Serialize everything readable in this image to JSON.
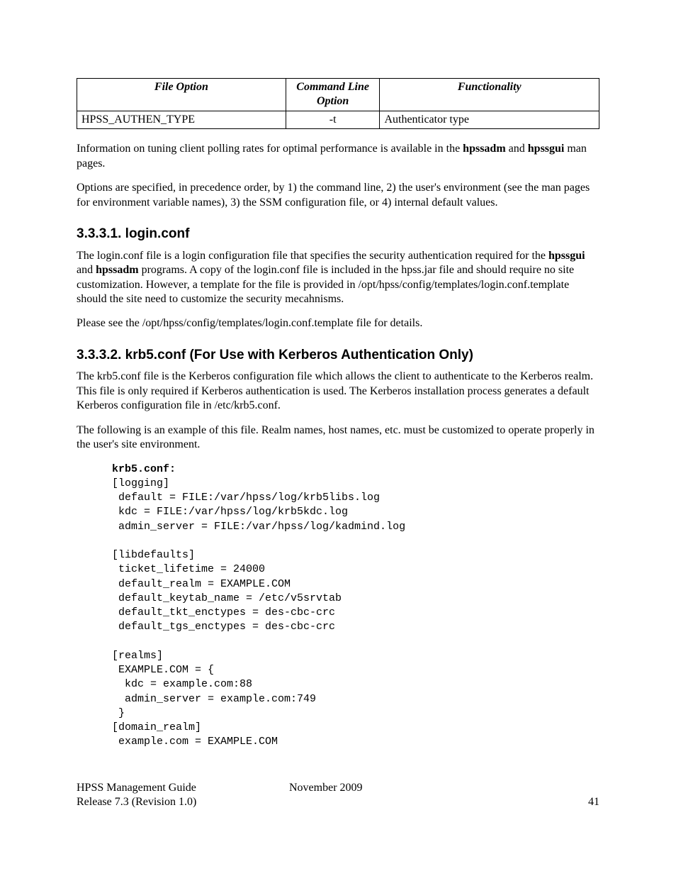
{
  "table": {
    "headers": [
      "File Option",
      "Command Line Option",
      "Functionality"
    ],
    "row": {
      "file": "HPSS_AUTHEN_TYPE",
      "cmd": "-t",
      "func": "Authenticator type"
    }
  },
  "p1a": "Information on tuning client polling rates for optimal performance is available in the ",
  "p1b": "hpssadm",
  "p1c": " and ",
  "p1d": "hpssgui",
  "p1e": " man pages.",
  "p2": "Options are specified, in precedence order, by 1) the command line, 2) the user's environment (see the man pages for environment variable names), 3) the SSM configuration file, or 4) internal default values.",
  "sec1": "3.3.3.1.   login.conf",
  "s1p1a": "The login.conf file is a login configuration file that specifies the security authentication required for the ",
  "s1p1b": "hpssgui",
  "s1p1c": " and ",
  "s1p1d": "hpssadm",
  "s1p1e": " programs.  A copy of the login.conf file is included in the hpss.jar file and should require no site customization.  However, a template for the file is provided in  /opt/hpss/config/templates/login.conf.template should the site need to customize the security mecahnisms.",
  "s1p2": "Please see the /opt/hpss/config/templates/login.conf.template file for details.",
  "sec2": "3.3.3.2.   krb5.conf (For Use with Kerberos Authentication Only)",
  "s2p1": "The krb5.conf file is the Kerberos configuration file which allows the client to authenticate to the Kerberos realm.  This file is only required if Kerberos authentication is used.  The Kerberos installation process generates a default Kerberos configuration file in /etc/krb5.conf.",
  "s2p2": "The following is an example of this file.  Realm names, host names, etc. must be customized to operate properly in the user's site environment.",
  "code_hdr": "krb5.conf:",
  "code_body": "[logging]\n default = FILE:/var/hpss/log/krb5libs.log\n kdc = FILE:/var/hpss/log/krb5kdc.log\n admin_server = FILE:/var/hpss/log/kadmind.log\n\n[libdefaults]\n ticket_lifetime = 24000\n default_realm = EXAMPLE.COM\n default_keytab_name = /etc/v5srvtab\n default_tkt_enctypes = des-cbc-crc\n default_tgs_enctypes = des-cbc-crc\n\n[realms]\n EXAMPLE.COM = {\n  kdc = example.com:88\n  admin_server = example.com:749\n }\n[domain_realm]\n example.com = EXAMPLE.COM",
  "footer": {
    "guide": "HPSS Management Guide",
    "date": "November 2009",
    "release": "Release 7.3 (Revision 1.0)",
    "page": "41"
  }
}
